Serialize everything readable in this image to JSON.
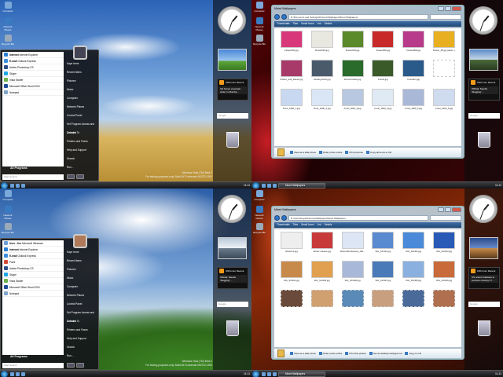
{
  "desktop_icons": [
    {
      "label": "Computer"
    },
    {
      "label": "Network Places"
    },
    {
      "label": "Recycle Bin"
    }
  ],
  "start_menu": {
    "left_items": [
      {
        "label": "Internet",
        "sub": "Internet Explorer",
        "color": "#2a7fd4"
      },
      {
        "label": "E-mail",
        "sub": "Outlook Express",
        "color": "#3a8de0"
      },
      {
        "label": "Adobe Photoshop CS",
        "sub": "",
        "color": "#2d4f8a"
      },
      {
        "label": "Skype",
        "sub": "",
        "color": "#1ea7e6"
      },
      {
        "label": "Vista Starter",
        "sub": "",
        "color": "#6ab04c"
      },
      {
        "label": "Microsoft Office Word 2003",
        "sub": "",
        "color": "#1f4e9a"
      },
      {
        "label": "Notepad",
        "sub": "",
        "color": "#7fa4c8"
      }
    ],
    "all_programs": "All Programs",
    "search_placeholder": "Start Search",
    "right_items": [
      "Kaye Irene",
      "Recent Items",
      "Pictures",
      "Music",
      "Computer",
      "Network Places",
      "Control Panel",
      "Set Program Access and Defaults",
      "Connect To",
      "Printers and Faxes",
      "Help and Support",
      "Search",
      "Run..."
    ]
  },
  "start_menu_b": {
    "left_items": [
      {
        "label": "User - Ker",
        "sub": "Microsoft Windows",
        "color": "#6aa0d8"
      },
      {
        "label": "Internet",
        "sub": "Internet Explorer",
        "color": "#2a7fd4"
      },
      {
        "label": "E-mail",
        "sub": "Outlook Express",
        "color": "#3a8de0"
      },
      {
        "label": "Paint",
        "sub": "",
        "color": "#d44a3a"
      },
      {
        "label": "Adobe Photoshop CS",
        "sub": "",
        "color": "#2d4f8a"
      },
      {
        "label": "Skype",
        "sub": "",
        "color": "#1ea7e6"
      },
      {
        "label": "Vista Starter",
        "sub": "",
        "color": "#6ab04c"
      },
      {
        "label": "Microsoft Office Word 2003",
        "sub": "",
        "color": "#1f4e9a"
      },
      {
        "label": "Notepad",
        "sub": "",
        "color": "#7fa4c8"
      }
    ],
    "all_programs": "All Programs",
    "search_placeholder": "Start Search",
    "right_items": [
      "Kaye Irene",
      "Recent Items",
      "Pictures",
      "Music",
      "Computer",
      "Network Places",
      "Control Panel",
      "Set Program Access and Defaults",
      "Connect To",
      "Printers and Faxes",
      "Help and Support",
      "Search",
      "Run..."
    ]
  },
  "sidebar": {
    "feed_title": "CNN.com Recent",
    "feed_headline_a": "US forces evacuate writer in Mumba...",
    "feed_headline_b": "Official: Saudis 'Mugging' ...",
    "feed_headline_c": "US orders Pakistan to produce missing 17 ...",
    "search_placeholder": "Google"
  },
  "watermark": {
    "line1": "Windows Vista (TM) Beta 2",
    "line2": "For testing purposes only. Build 5474.winmain.060722-1900"
  },
  "taskbar": {
    "time": "11:11",
    "task_label": "Mixed Wallpapers"
  },
  "explorer_a": {
    "title": "Mixed Wallpapers",
    "address": "D:\\Dcuments and Settings\\Pictures\\Wallpaper\\Mixed Wallpapers",
    "toolbar": [
      "Thumbnails",
      "Tiles",
      "Small Icons",
      "List",
      "Details"
    ],
    "files": [
      "Flower002.jpg",
      "Flower003.jpg",
      "Flower004.jpg",
      "Flower006.jpg",
      "Flower008.jpg",
      "Flower_45.jpg (artist...)",
      "Flower_and_leaves.jpg",
      "Flowing Rock.jpg",
      "Forest Flower.jpg",
      "Forest.jpg",
      "Fountain.jpg",
      "",
      "Frost_1600_1.jpg",
      "Frost_1600_2.jpg",
      "Frost_1600_3.jpg",
      "Frost_1600_4.jpg",
      "Frost_1600_5.jpg",
      "Frost_1600_6.jpg"
    ],
    "actions": [
      "View as a slide show",
      "Order prints online",
      "Print pictures",
      "Copy all items to CD"
    ]
  },
  "explorer_b": {
    "title": "Mixed Wallpapers",
    "address": "D:\\Users\\Kaye\\Pictures\\Wallpaper\\Mixed Wallpapers",
    "toolbar": [
      "Thumbnails",
      "Tiles",
      "Small Icons",
      "List",
      "Details"
    ],
    "files": [
      "Winter12.jpg",
      "Winter release.jpg",
      "WinterWonderland_160...",
      "WG_SCN01.jpg",
      "WG_SCN02.jpg",
      "WG_SCN03.jpg",
      "WG_SCN04.jpg",
      "WG_SCN05.jpg",
      "WG_SCN06.jpg",
      "WG_SCN07.jpg",
      "WG_SCN08.jpg",
      "WG_SCN09.jpg",
      "",
      "",
      "",
      "",
      "",
      ""
    ],
    "actions": [
      "View as a slide show",
      "Order prints online",
      "Print this picture",
      "Set as desktop background",
      "Copy to CD"
    ]
  },
  "thumb_colors_a": [
    "#d8387a",
    "#e8e8e0",
    "#5a8a2a",
    "#c82a2a",
    "#b83a8a",
    "#e8b020",
    "#a83a6a",
    "#4a5a6a",
    "#2a6a2a",
    "#3a5a2a",
    "#2a5a8a",
    "#ffffff",
    "#c8d8f0",
    "#dae6f5",
    "#b8c8e0",
    "#e0eaf5",
    "#aab8d8",
    "#cfdcf0"
  ],
  "thumb_colors_b": [
    "#eeeeee",
    "#c83a3a",
    "#dde6f5",
    "#5a8ad0",
    "#4a8ad8",
    "#2a5ab8",
    "#c88a4a",
    "#e0a050",
    "#a8b8d8",
    "#4a7ab8",
    "#8ab0e0",
    "#c86a3a",
    "#6a4a3a",
    "#d0a070",
    "#5a8ab8",
    "#c8a080",
    "#4a6a9a",
    "#b07050"
  ]
}
